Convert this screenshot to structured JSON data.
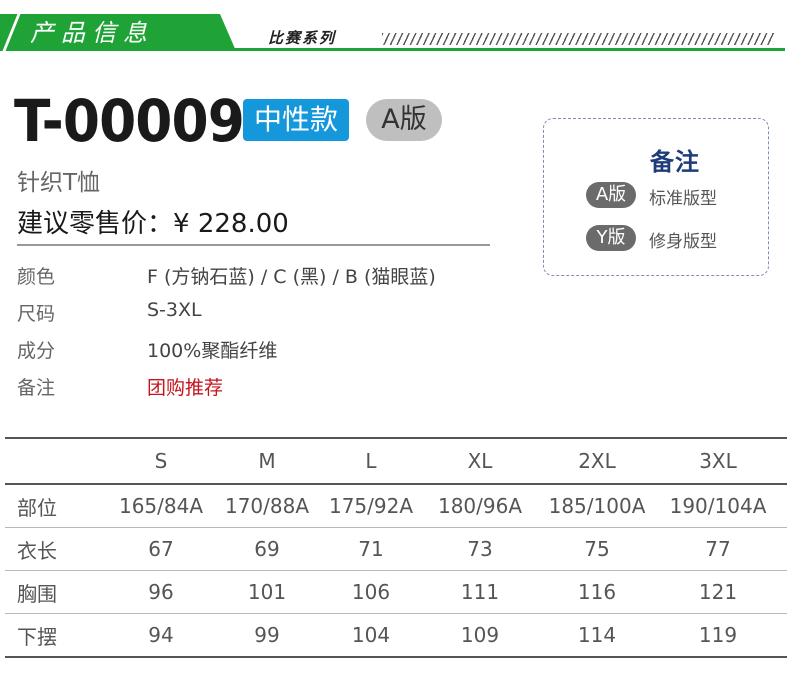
{
  "header": {
    "title": "产品信息",
    "series": "比赛系列"
  },
  "product": {
    "code": "T-00009",
    "gender_tag": "中性款",
    "fit_tag": "A版",
    "name": "针织T恤",
    "price_label": "建议零售价：",
    "price": "¥ 228.00"
  },
  "specs": [
    {
      "label": "颜色",
      "value": "F (方钠石蓝) / C (黑) / B (猫眼蓝)"
    },
    {
      "label": "尺码",
      "value": "S-3XL"
    },
    {
      "label": "成分",
      "value": "100%聚酯纤维"
    },
    {
      "label": "备注",
      "value": "团购推荐"
    }
  ],
  "note": {
    "title": "备注",
    "items": [
      {
        "tag": "A版",
        "desc": "标准版型"
      },
      {
        "tag": "Y版",
        "desc": "修身版型"
      }
    ]
  },
  "size_table": {
    "columns": [
      "",
      "S",
      "M",
      "L",
      "XL",
      "2XL",
      "3XL"
    ],
    "rows": [
      {
        "label": "部位",
        "values": [
          "165/84A",
          "170/88A",
          "175/92A",
          "180/96A",
          "185/100A",
          "190/104A"
        ]
      },
      {
        "label": "衣长",
        "values": [
          "67",
          "69",
          "71",
          "73",
          "75",
          "77"
        ]
      },
      {
        "label": "胸围",
        "values": [
          "96",
          "101",
          "106",
          "111",
          "116",
          "121"
        ]
      },
      {
        "label": "下摆",
        "values": [
          "94",
          "99",
          "104",
          "109",
          "114",
          "119"
        ]
      }
    ]
  },
  "colors": {
    "brand_green": "#1fa337",
    "tag_blue": "#1597dc",
    "note_title": "#1e3b7a",
    "highlight_red": "#c4141c"
  }
}
